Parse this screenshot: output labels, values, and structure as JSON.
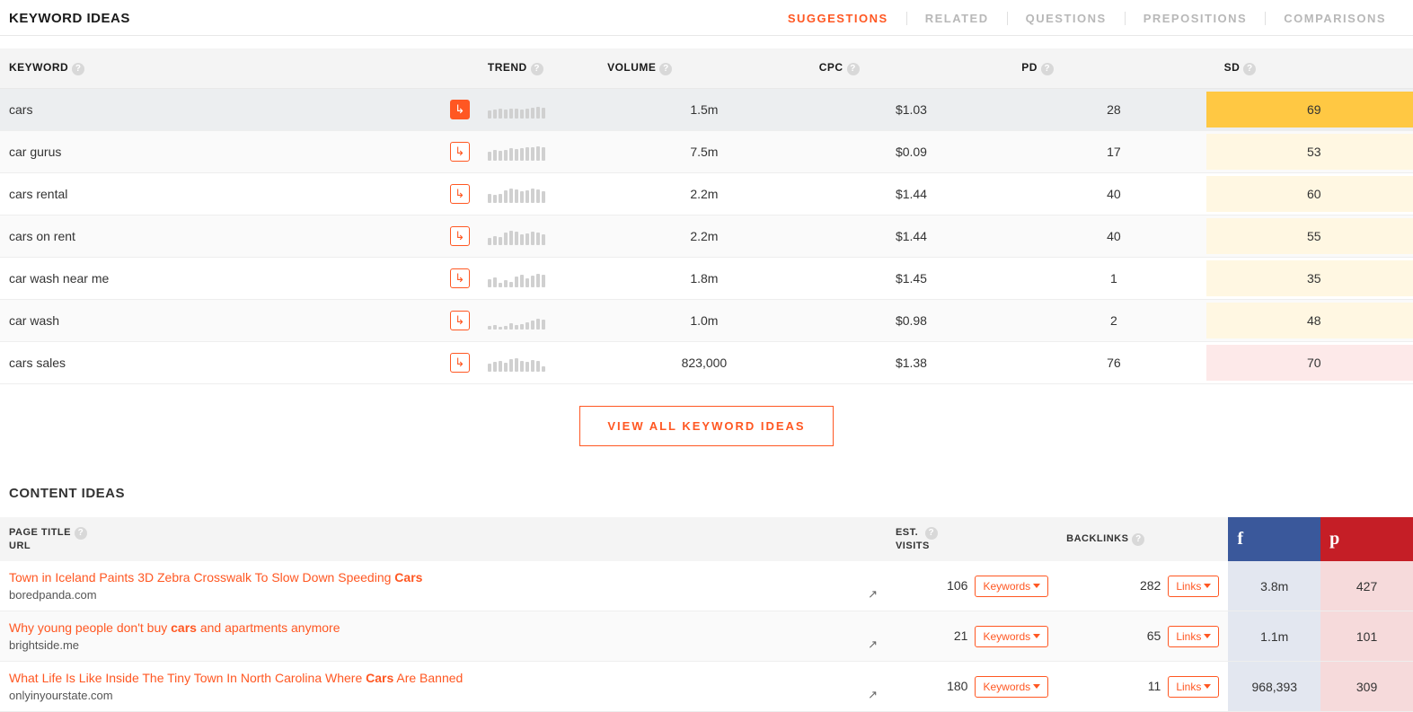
{
  "keyword_ideas": {
    "title": "KEYWORD IDEAS",
    "tabs": [
      "SUGGESTIONS",
      "RELATED",
      "QUESTIONS",
      "PREPOSITIONS",
      "COMPARISONS"
    ],
    "active_tab": 0,
    "headers": {
      "keyword": "KEYWORD",
      "trend": "TREND",
      "volume": "VOLUME",
      "cpc": "CPC",
      "pd": "PD",
      "sd": "SD"
    },
    "rows": [
      {
        "keyword": "cars",
        "volume": "1.5m",
        "cpc": "$1.03",
        "pd": "28",
        "sd": "69",
        "selected": true,
        "sd_class": "sd-69",
        "trend": [
          9,
          10,
          11,
          10,
          11,
          11,
          10,
          11,
          12,
          13,
          12
        ]
      },
      {
        "keyword": "car gurus",
        "volume": "7.5m",
        "cpc": "$0.09",
        "pd": "17",
        "sd": "53",
        "sd_class": "sd-urange",
        "trend": [
          10,
          12,
          11,
          12,
          14,
          13,
          14,
          15,
          15,
          16,
          15
        ]
      },
      {
        "keyword": "cars rental",
        "volume": "2.2m",
        "cpc": "$1.44",
        "pd": "40",
        "sd": "60",
        "sd_class": "sd-urange",
        "trend": [
          10,
          9,
          10,
          14,
          16,
          15,
          13,
          14,
          16,
          15,
          13
        ]
      },
      {
        "keyword": "cars on rent",
        "volume": "2.2m",
        "cpc": "$1.44",
        "pd": "40",
        "sd": "55",
        "sd_class": "sd-urange",
        "trend": [
          8,
          10,
          9,
          14,
          16,
          15,
          12,
          13,
          15,
          14,
          12
        ]
      },
      {
        "keyword": "car wash near me",
        "volume": "1.8m",
        "cpc": "$1.45",
        "pd": "1",
        "sd": "35",
        "sd_class": "sd-urange",
        "trend": [
          9,
          11,
          5,
          8,
          6,
          12,
          14,
          10,
          13,
          15,
          14
        ]
      },
      {
        "keyword": "car wash",
        "volume": "1.0m",
        "cpc": "$0.98",
        "pd": "2",
        "sd": "48",
        "sd_class": "sd-urange",
        "trend": [
          4,
          5,
          3,
          4,
          7,
          5,
          6,
          8,
          10,
          12,
          11
        ]
      },
      {
        "keyword": "cars sales",
        "volume": "823,000",
        "cpc": "$1.38",
        "pd": "76",
        "sd": "70",
        "sd_class": "sd-pink",
        "trend": [
          9,
          11,
          12,
          10,
          14,
          15,
          12,
          11,
          13,
          12,
          6
        ]
      }
    ],
    "view_all": "VIEW ALL KEYWORD IDEAS"
  },
  "content_ideas": {
    "title": "CONTENT IDEAS",
    "headers": {
      "page_title": "PAGE TITLE",
      "url_label": "URL",
      "est": "EST.\nVISITS",
      "backlinks": "BACKLINKS"
    },
    "btn_keywords": "Keywords",
    "btn_links": "Links",
    "rows": [
      {
        "title_pre": "Town in Iceland Paints 3D Zebra Crosswalk To Slow Down Speeding ",
        "title_bold": "Cars",
        "title_post": "",
        "url": "boredpanda.com",
        "est": "106",
        "backlinks": "282",
        "fb": "3.8m",
        "pin": "427"
      },
      {
        "title_pre": "Why young people don't buy ",
        "title_bold": "cars",
        "title_post": " and apartments anymore",
        "url": "brightside.me",
        "est": "21",
        "backlinks": "65",
        "fb": "1.1m",
        "pin": "101"
      },
      {
        "title_pre": "What Life Is Like Inside The Tiny Town In North Carolina Where ",
        "title_bold": "Cars",
        "title_post": " Are Banned",
        "url": "onlyinyourstate.com",
        "est": "180",
        "backlinks": "11",
        "fb": "968,393",
        "pin": "309"
      }
    ]
  }
}
